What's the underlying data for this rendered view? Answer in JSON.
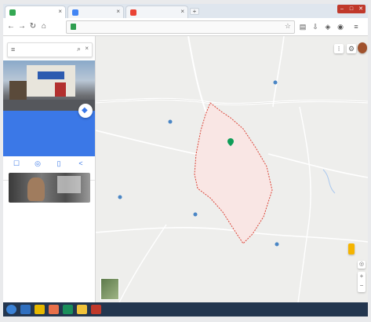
{
  "browser": {
    "tabs": [
      {
        "title": "",
        "color": "#34a853",
        "active": true
      },
      {
        "title": "",
        "color": "#4285f4",
        "active": false
      },
      {
        "title": "",
        "color": "#ea4335",
        "active": false
      }
    ],
    "url": "",
    "window_buttons": [
      "–",
      "□",
      "✕"
    ]
  },
  "panel": {
    "search_query": "",
    "place_name": "",
    "place_line2": "",
    "place_line3": "",
    "directions_label": "",
    "actions": [
      {
        "icon": "bookmark-icon",
        "glyph": "☐",
        "label": ""
      },
      {
        "icon": "nearby-icon",
        "glyph": "◎",
        "label": ""
      },
      {
        "icon": "phone-icon",
        "glyph": "▯",
        "label": ""
      },
      {
        "icon": "share-icon",
        "glyph": "<",
        "label": ""
      }
    ]
  },
  "map": {
    "region_fill": "#f9e6e4",
    "region_stroke": "#db4437",
    "place_labels": [
      {
        "id": "label-1",
        "text": ""
      },
      {
        "id": "label-2",
        "text": ""
      },
      {
        "id": "label-3",
        "text": ""
      },
      {
        "id": "label-4",
        "text": ""
      },
      {
        "id": "label-5",
        "text": ""
      },
      {
        "id": "label-6",
        "text": ""
      },
      {
        "id": "label-7",
        "text": ""
      },
      {
        "id": "label-8",
        "text": ""
      },
      {
        "id": "label-9",
        "text": ""
      },
      {
        "id": "label-10",
        "text": ""
      },
      {
        "id": "label-11",
        "text": ""
      },
      {
        "id": "label-12",
        "text": ""
      },
      {
        "id": "label-13",
        "text": ""
      },
      {
        "id": "label-14",
        "text": ""
      },
      {
        "id": "label-15",
        "text": ""
      },
      {
        "id": "label-16",
        "text": ""
      },
      {
        "id": "label-17",
        "text": ""
      }
    ],
    "center_label": "",
    "footer_text": "",
    "logo_text": ""
  },
  "taskbar": {
    "clock": ""
  }
}
